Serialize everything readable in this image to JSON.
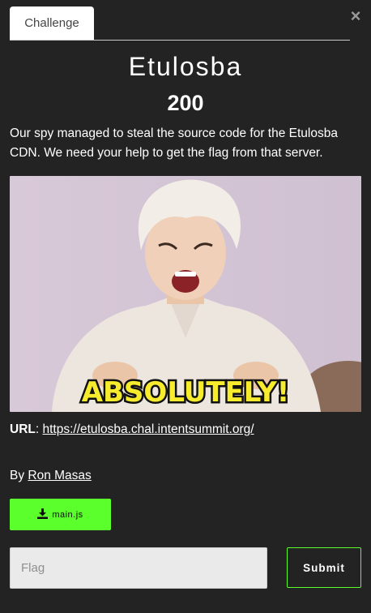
{
  "tabs": [
    {
      "label": "Challenge"
    }
  ],
  "close_label": "×",
  "challenge": {
    "name": "Etulosba",
    "points": "200",
    "description": "Our spy managed to steal the source code for the Etulosba CDN. We need your help to get the flag from that server.",
    "image_caption": "ABSOLUTELY!",
    "url_label": "URL",
    "url_sep": ":",
    "url": "https://etulosba.chal.intentsummit.org/",
    "author_prefix": "By",
    "author": "Ron Masas",
    "file_name": "main.js"
  },
  "form": {
    "flag_placeholder": "Flag",
    "submit_label": "Submit"
  },
  "colors": {
    "accent": "#5bff2c",
    "background": "#232323"
  },
  "icons": [
    "close-icon",
    "download-icon"
  ]
}
